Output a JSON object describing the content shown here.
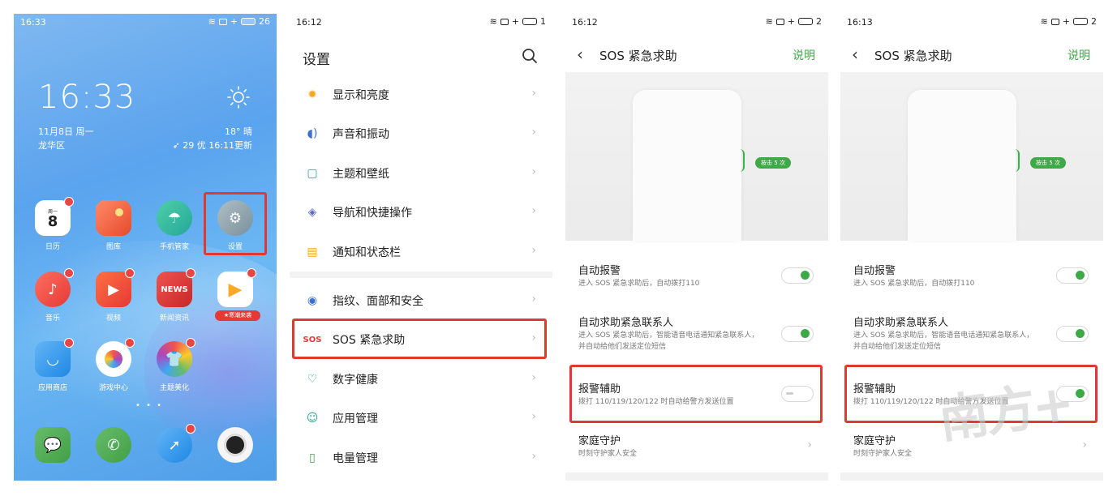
{
  "home": {
    "status_time": "16:33",
    "battery": "26",
    "clock": "16:33",
    "date": "11月8日 周一",
    "district": "龙华区",
    "temp": "18° 晴",
    "aqi": "29 优 16:11更新",
    "calendar_day": "周一",
    "calendar_num": "8",
    "news_text": "NEWS",
    "promo_badge": "★寒潮来袭",
    "apps": [
      {
        "label": "日历"
      },
      {
        "label": "图库"
      },
      {
        "label": "手机管家"
      },
      {
        "label": "设置"
      },
      {
        "label": "音乐"
      },
      {
        "label": "视频"
      },
      {
        "label": "新闻资讯"
      },
      {
        "label": ""
      },
      {
        "label": "应用商店"
      },
      {
        "label": "游戏中心"
      },
      {
        "label": "主题美化"
      }
    ]
  },
  "settings": {
    "status_time": "16:12",
    "battery": "1",
    "title": "设置",
    "sos_icon_text": "SOS",
    "items": [
      {
        "label": "显示和亮度",
        "icon": "sun-icon"
      },
      {
        "label": "声音和振动",
        "icon": "speaker-icon"
      },
      {
        "label": "主题和壁纸",
        "icon": "theme-icon"
      },
      {
        "label": "导航和快捷操作",
        "icon": "navigation-icon"
      },
      {
        "label": "通知和状态栏",
        "icon": "notification-icon"
      },
      {
        "label": "指纹、面部和安全",
        "icon": "fingerprint-icon"
      },
      {
        "label": "SOS 紧急求助",
        "icon": "sos-icon"
      },
      {
        "label": "数字健康",
        "icon": "heart-icon"
      },
      {
        "label": "应用管理",
        "icon": "apps-icon"
      },
      {
        "label": "电量管理",
        "icon": "battery-icon"
      }
    ]
  },
  "sos_a": {
    "status_time": "16:12",
    "battery": "2",
    "title": "SOS 紧急求助",
    "help": "说明",
    "press_tag": "按击 5 次",
    "options": [
      {
        "title": "自动报警",
        "desc": "进入 SOS 紧急求助后，自动拨打110",
        "state": "on"
      },
      {
        "title": "自动求助紧急联系人",
        "desc": "进入 SOS 紧急求助后，智能语音电话通知紧急联系人，并自动给他们发送定位短信",
        "state": "on"
      },
      {
        "title": "报警辅助",
        "desc": "拨打 110/119/120/122 时自动给警方发送位置",
        "state": "off"
      },
      {
        "title": "家庭守护",
        "desc": "时刻守护家人安全",
        "state": "chevron"
      }
    ]
  },
  "sos_b": {
    "status_time": "16:13",
    "battery": "2",
    "title": "SOS 紧急求助",
    "help": "说明",
    "press_tag": "按击 5 次",
    "watermark": "南方+",
    "options": [
      {
        "title": "自动报警",
        "desc": "进入 SOS 紧急求助后，自动拨打110",
        "state": "on"
      },
      {
        "title": "自动求助紧急联系人",
        "desc": "进入 SOS 紧急求助后，智能语音电话通知紧急联系人，并自动给他们发送定位短信",
        "state": "on"
      },
      {
        "title": "报警辅助",
        "desc": "拨打 110/119/120/122 时自动给警方发送位置",
        "state": "on"
      },
      {
        "title": "家庭守护",
        "desc": "时刻守护家人安全",
        "state": "chevron"
      }
    ]
  }
}
